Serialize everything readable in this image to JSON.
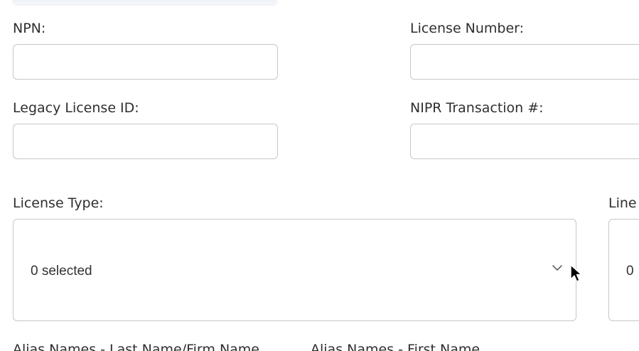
{
  "form": {
    "npn": {
      "label": "NPN:",
      "value": ""
    },
    "license_number": {
      "label": "License Number:",
      "value": ""
    },
    "legacy_license_id": {
      "label": "Legacy License ID:",
      "value": ""
    },
    "nipr_transaction": {
      "label": "NIPR Transaction #:",
      "value": ""
    },
    "license_type": {
      "label": "License Type:",
      "selected_text": "0 selected"
    },
    "line": {
      "label": "Line",
      "selected_text": "0"
    },
    "alias_last": {
      "label": "Alias Names - Last Name/Firm Name"
    },
    "alias_first": {
      "label": "Alias Names - First Name"
    }
  },
  "icons": {
    "dropdown": "chevron-down-icon",
    "cursor": "mouse-pointer-icon"
  }
}
